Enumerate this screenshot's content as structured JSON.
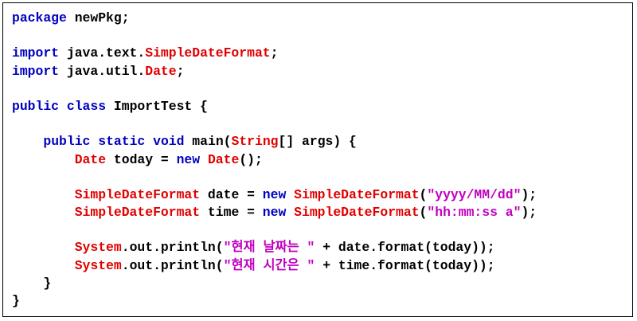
{
  "code": {
    "colors": {
      "keyword": "#0000c0",
      "type": "#e00000",
      "string": "#c000c0",
      "plain": "#000000"
    },
    "lines": [
      [
        {
          "t": "package",
          "k": "kw"
        },
        {
          "t": " newPkg;",
          "k": "pl"
        }
      ],
      [],
      [
        {
          "t": "import",
          "k": "kw"
        },
        {
          "t": " java.text.",
          "k": "pl"
        },
        {
          "t": "SimpleDateFormat",
          "k": "ty"
        },
        {
          "t": ";",
          "k": "pl"
        }
      ],
      [
        {
          "t": "import",
          "k": "kw"
        },
        {
          "t": " java.util.",
          "k": "pl"
        },
        {
          "t": "Date",
          "k": "ty"
        },
        {
          "t": ";",
          "k": "pl"
        }
      ],
      [],
      [
        {
          "t": "public",
          "k": "kw"
        },
        {
          "t": " ",
          "k": "pl"
        },
        {
          "t": "class",
          "k": "kw"
        },
        {
          "t": " ImportTest {",
          "k": "pl"
        }
      ],
      [],
      [
        {
          "t": "    ",
          "k": "pl"
        },
        {
          "t": "public",
          "k": "kw"
        },
        {
          "t": " ",
          "k": "pl"
        },
        {
          "t": "static",
          "k": "kw"
        },
        {
          "t": " ",
          "k": "pl"
        },
        {
          "t": "void",
          "k": "kw"
        },
        {
          "t": " main(",
          "k": "pl"
        },
        {
          "t": "String",
          "k": "ty"
        },
        {
          "t": "[] args) {",
          "k": "pl"
        }
      ],
      [
        {
          "t": "        ",
          "k": "pl"
        },
        {
          "t": "Date",
          "k": "ty"
        },
        {
          "t": " today = ",
          "k": "pl"
        },
        {
          "t": "new",
          "k": "kw"
        },
        {
          "t": " ",
          "k": "pl"
        },
        {
          "t": "Date",
          "k": "ty"
        },
        {
          "t": "();",
          "k": "pl"
        }
      ],
      [],
      [
        {
          "t": "        ",
          "k": "pl"
        },
        {
          "t": "SimpleDateFormat",
          "k": "ty"
        },
        {
          "t": " date = ",
          "k": "pl"
        },
        {
          "t": "new",
          "k": "kw"
        },
        {
          "t": " ",
          "k": "pl"
        },
        {
          "t": "SimpleDateFormat",
          "k": "ty"
        },
        {
          "t": "(",
          "k": "pl"
        },
        {
          "t": "\"yyyy/MM/dd\"",
          "k": "st"
        },
        {
          "t": ");",
          "k": "pl"
        }
      ],
      [
        {
          "t": "        ",
          "k": "pl"
        },
        {
          "t": "SimpleDateFormat",
          "k": "ty"
        },
        {
          "t": " time = ",
          "k": "pl"
        },
        {
          "t": "new",
          "k": "kw"
        },
        {
          "t": " ",
          "k": "pl"
        },
        {
          "t": "SimpleDateFormat",
          "k": "ty"
        },
        {
          "t": "(",
          "k": "pl"
        },
        {
          "t": "\"hh:mm:ss a\"",
          "k": "st"
        },
        {
          "t": ");",
          "k": "pl"
        }
      ],
      [],
      [
        {
          "t": "        ",
          "k": "pl"
        },
        {
          "t": "System",
          "k": "ty"
        },
        {
          "t": ".out.println(",
          "k": "pl"
        },
        {
          "t": "\"현재 날짜는 \"",
          "k": "st"
        },
        {
          "t": " + date.format(today));",
          "k": "pl"
        }
      ],
      [
        {
          "t": "        ",
          "k": "pl"
        },
        {
          "t": "System",
          "k": "ty"
        },
        {
          "t": ".out.println(",
          "k": "pl"
        },
        {
          "t": "\"현재 시간은 \"",
          "k": "st"
        },
        {
          "t": " + time.format(today));",
          "k": "pl"
        }
      ],
      [
        {
          "t": "    }",
          "k": "pl"
        }
      ],
      [
        {
          "t": "}",
          "k": "pl"
        }
      ]
    ]
  }
}
